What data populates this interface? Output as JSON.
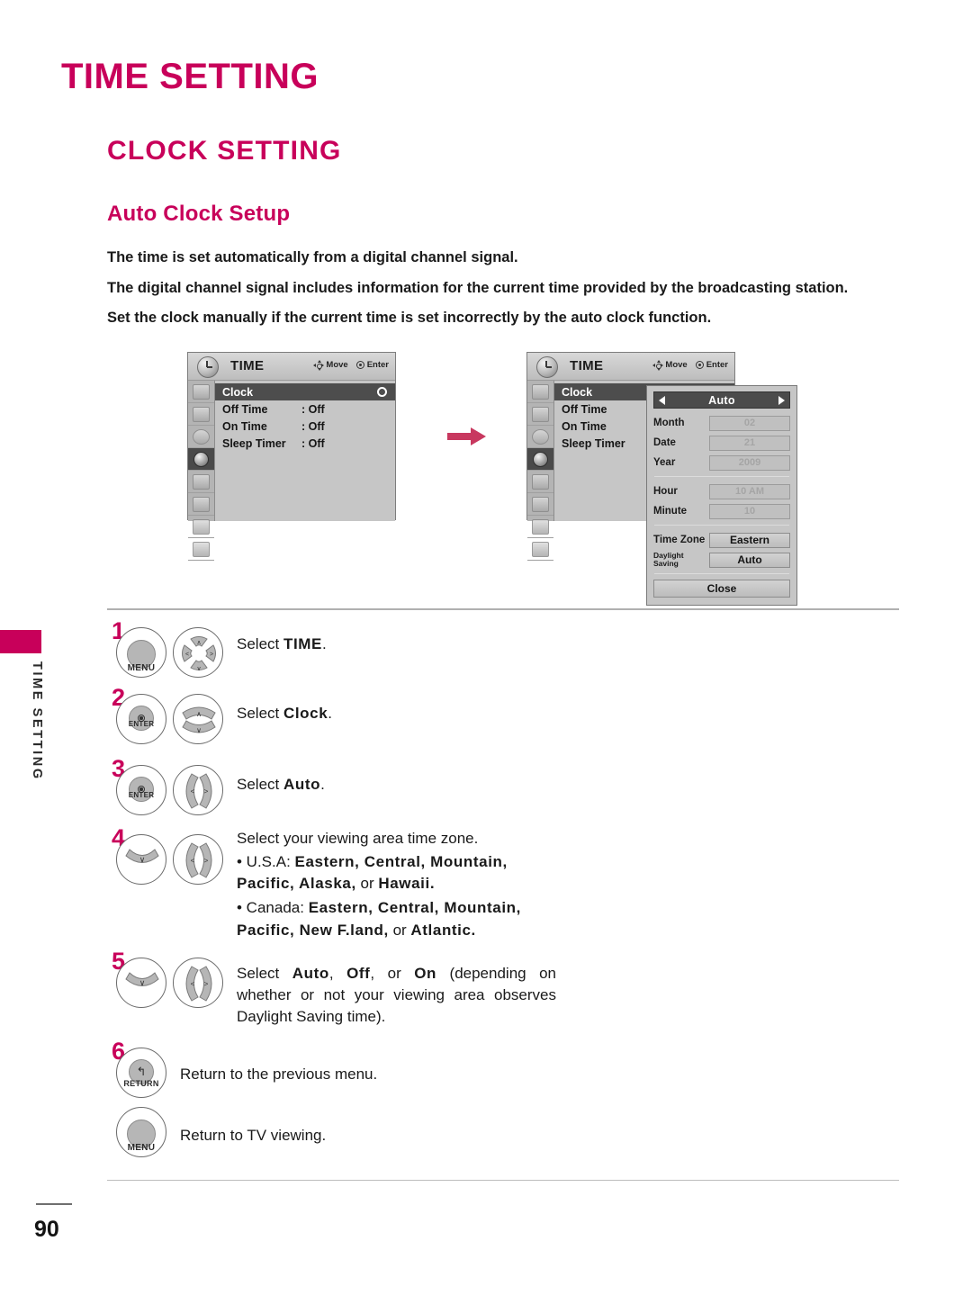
{
  "page": {
    "number": "90",
    "side_tab_label": "TIME SETTING"
  },
  "headings": {
    "chapter": "TIME SETTING",
    "section": "CLOCK SETTING",
    "subsection": "Auto Clock Setup",
    "accent_color": "#c8005a"
  },
  "intro_paragraphs": [
    "The time is set automatically from a digital channel signal.",
    "The digital channel signal includes information for the current time provided by the broadcasting station.",
    "Set the clock manually if the current time is set incorrectly by the auto clock function."
  ],
  "osd": {
    "title": "TIME",
    "hints": {
      "move": "Move",
      "enter": "Enter"
    },
    "menu_rows": [
      {
        "label": "Clock",
        "value": "",
        "highlighted": true
      },
      {
        "label": "Off Time",
        "value": ": Off",
        "highlighted": false
      },
      {
        "label": "On Time",
        "value": ": Off",
        "highlighted": false
      },
      {
        "label": "Sleep Timer",
        "value": ": Off",
        "highlighted": false
      }
    ],
    "rail_icons": [
      "picture-icon",
      "audio-icon",
      "time-alarm-icon",
      "time-clock-icon",
      "option-icon",
      "lock-icon",
      "input-icon",
      "usb-icon"
    ],
    "selected_rail_index": 3,
    "menu_rows_second": [
      {
        "label": "Clock",
        "value": "",
        "highlighted": true
      },
      {
        "label": "Off Time",
        "value": "",
        "highlighted": false
      },
      {
        "label": "On Time",
        "value": "",
        "highlighted": false
      },
      {
        "label": "Sleep Timer",
        "value": "",
        "highlighted": false
      }
    ]
  },
  "auto_dialog": {
    "header": "Auto",
    "rows": [
      {
        "label": "Month",
        "value": "02",
        "enabled": false
      },
      {
        "label": "Date",
        "value": "21",
        "enabled": false
      },
      {
        "label": "Year",
        "value": "2009",
        "enabled": false
      },
      {
        "label": "Hour",
        "value": "10 AM",
        "enabled": false
      },
      {
        "label": "Minute",
        "value": "10",
        "enabled": false
      },
      {
        "label": "Time Zone",
        "value": "Eastern",
        "enabled": true
      },
      {
        "label": "Daylight Saving",
        "value": "Auto",
        "enabled": true
      }
    ],
    "close_label": "Close"
  },
  "steps": [
    {
      "num": "1",
      "buttons": [
        {
          "type": "round",
          "caption": "MENU"
        },
        {
          "type": "dpad4"
        }
      ],
      "text_plain_1": "Select ",
      "text_bold_1": "TIME",
      "text_plain_2": "."
    },
    {
      "num": "2",
      "buttons": [
        {
          "type": "enter",
          "caption": "ENTER"
        },
        {
          "type": "updown"
        }
      ],
      "text_plain_1": "Select ",
      "text_bold_1": "Clock",
      "text_plain_2": "."
    },
    {
      "num": "3",
      "buttons": [
        {
          "type": "enter",
          "caption": "ENTER"
        },
        {
          "type": "leftright"
        }
      ],
      "text_plain_1": "Select ",
      "text_bold_1": "Auto",
      "text_plain_2": "."
    },
    {
      "num": "4",
      "buttons": [
        {
          "type": "down"
        },
        {
          "type": "leftright"
        }
      ],
      "heading": "Select your viewing area time zone.",
      "bullet_usa_prefix": "• U.S.A:",
      "bullet_usa_zones": "Eastern,  Central,  Mountain, Pacific, Alaska,",
      "bullet_usa_or": "or",
      "bullet_usa_last": "Hawaii.",
      "bullet_canada_prefix": "• Canada:",
      "bullet_canada_zones": "Eastern,  Central,  Mountain, Pacific, New F.land,",
      "bullet_canada_or": "or",
      "bullet_canada_last": "Atlantic."
    },
    {
      "num": "5",
      "buttons": [
        {
          "type": "down"
        },
        {
          "type": "leftright"
        }
      ],
      "text_a": "Select",
      "opt1": "Auto",
      "sep1": ",",
      "opt2": "Off",
      "sep2": ", or",
      "opt3": "On",
      "tail": "(depending on whether or not your viewing area observes Daylight Saving time)."
    },
    {
      "num": "6",
      "buttons": [
        {
          "type": "return",
          "caption": "RETURN"
        }
      ],
      "text": "Return to the previous menu."
    },
    {
      "num": "",
      "buttons": [
        {
          "type": "round",
          "caption": "MENU"
        }
      ],
      "text": "Return to TV viewing."
    }
  ]
}
